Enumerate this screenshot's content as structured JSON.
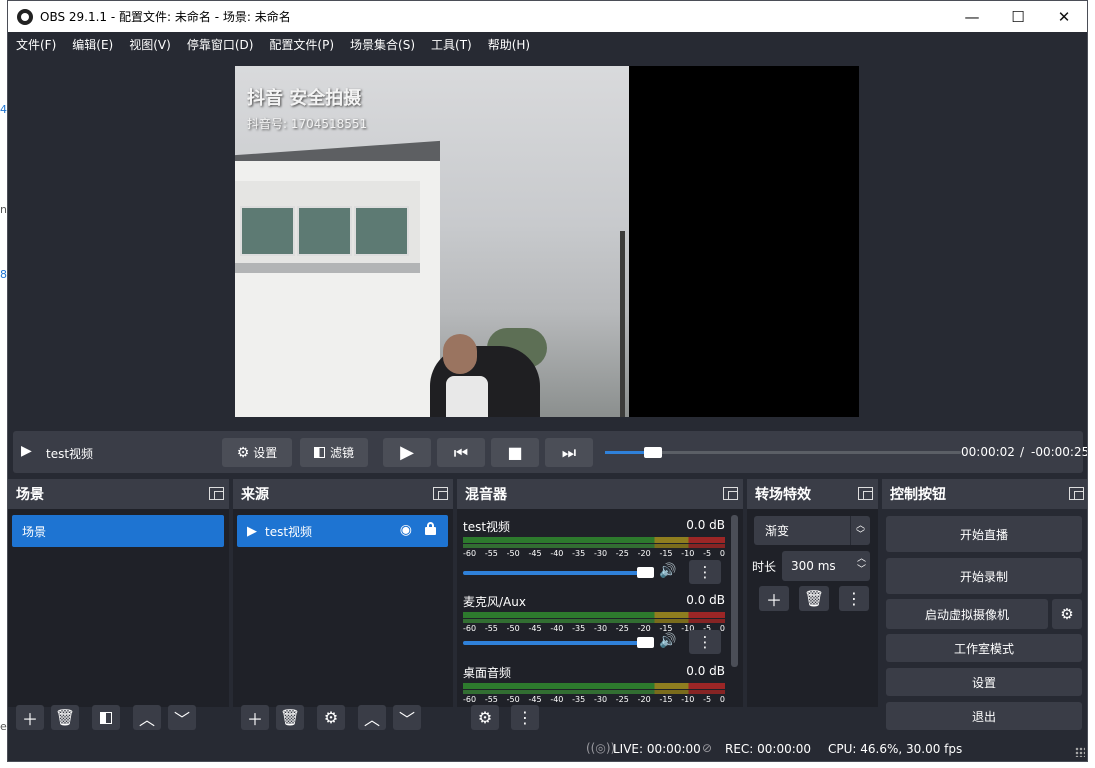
{
  "background": {
    "fragments": [
      "4",
      "n",
      "8",
      "e"
    ]
  },
  "window": {
    "title": "OBS 29.1.1 - 配置文件: 未命名 - 场景: 未命名",
    "controls": {
      "minimize": "—",
      "maximize": "☐",
      "close": "✕"
    }
  },
  "menu": [
    "文件(F)",
    "编辑(E)",
    "视图(V)",
    "停靠窗口(D)",
    "配置文件(P)",
    "场景集合(S)",
    "工具(T)",
    "帮助(H)"
  ],
  "preview": {
    "watermark_title": "抖音 安全拍摄",
    "watermark_id": "抖音号: 1704518551"
  },
  "media": {
    "source_name": "test视频",
    "settings_label": "设置",
    "filters_label": "滤镜",
    "elapsed": "00:00:02",
    "separator": "/",
    "remaining": "-00:00:25",
    "progress": 0.12
  },
  "scenes": {
    "title": "场景",
    "items": [
      "场景"
    ]
  },
  "sources": {
    "title": "来源",
    "items": [
      {
        "name": "test视频"
      }
    ]
  },
  "mixer": {
    "title": "混音器",
    "scale": [
      "-60",
      "-55",
      "-50",
      "-45",
      "-40",
      "-35",
      "-30",
      "-25",
      "-20",
      "-15",
      "-10",
      "-5",
      "0"
    ],
    "tracks": [
      {
        "name": "test视频",
        "level": "0.0 dB"
      },
      {
        "name": "麦克风/Aux",
        "level": "0.0 dB"
      },
      {
        "name": "桌面音频",
        "level": "0.0 dB"
      }
    ]
  },
  "transitions": {
    "title": "转场特效",
    "type": "渐变",
    "duration_label": "时长",
    "duration_value": "300 ms"
  },
  "controls": {
    "title": "控制按钮",
    "start_stream": "开始直播",
    "start_record": "开始录制",
    "virtual_camera": "启动虚拟摄像机",
    "studio_mode": "工作室模式",
    "settings": "设置",
    "exit": "退出"
  },
  "status": {
    "live": "LIVE: 00:00:00",
    "rec": "REC: 00:00:00",
    "cpu": "CPU: 46.6%, 30.00 fps"
  },
  "colors": {
    "accent": "#1e74d2",
    "panel": "#3a3d47",
    "background": "#272a33",
    "dock_body": "#1f2128"
  }
}
